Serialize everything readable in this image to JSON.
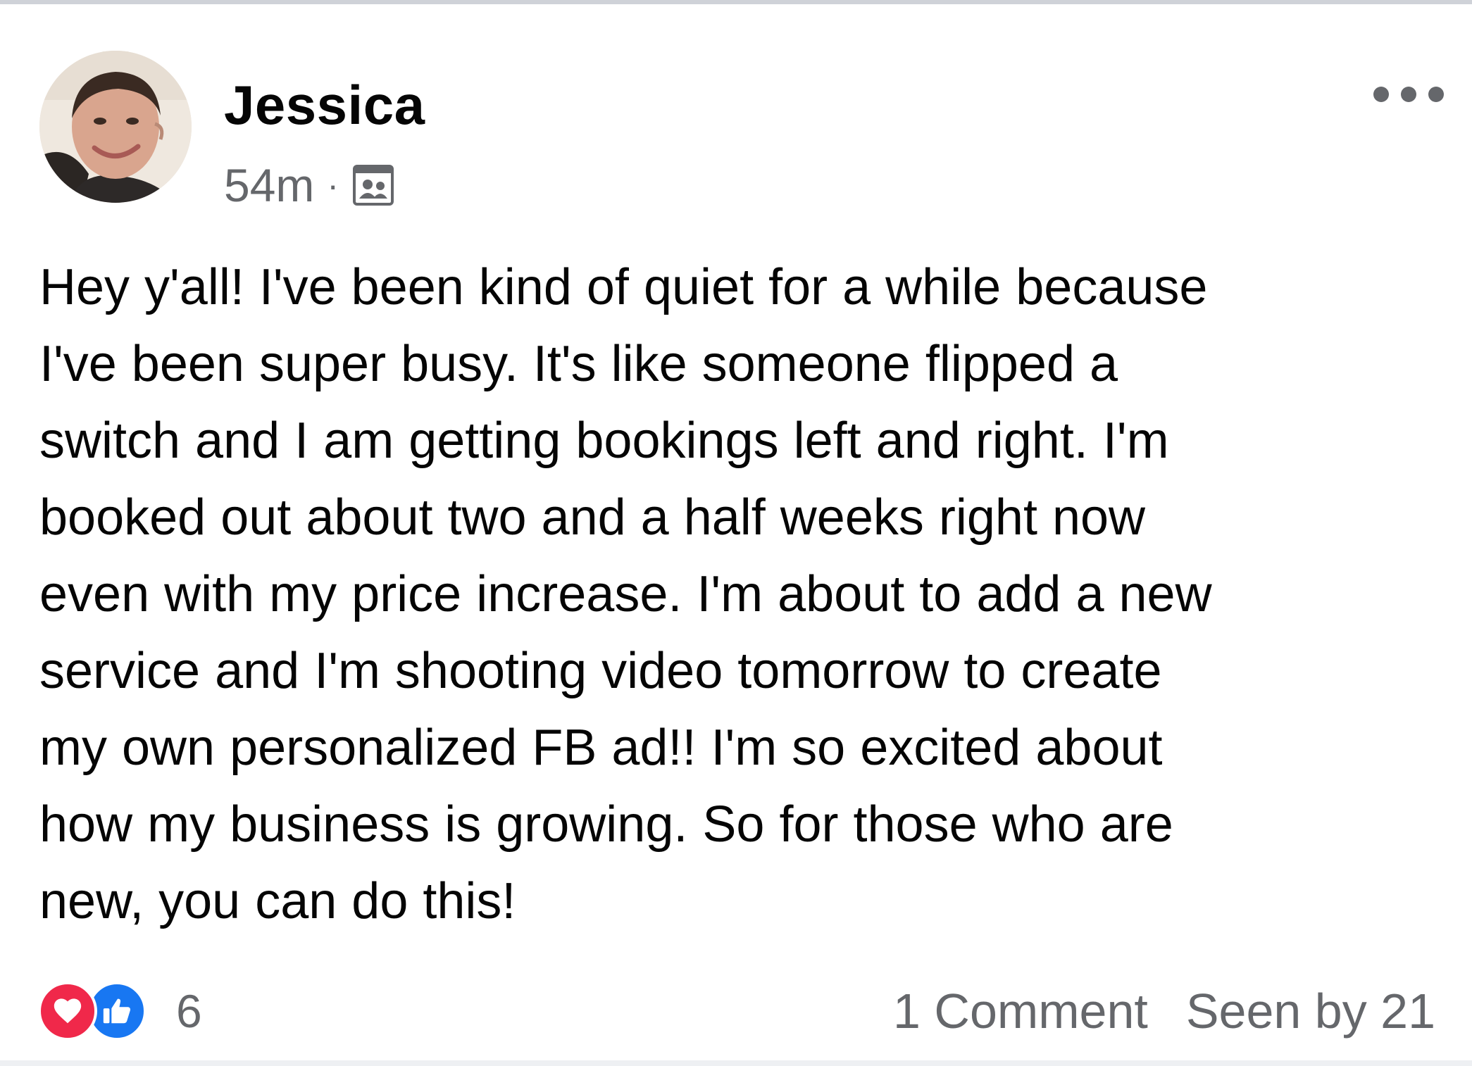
{
  "post": {
    "author": {
      "name": "Jessica",
      "avatar_icon": "user-avatar-photo"
    },
    "meta": {
      "timestamp": "54m",
      "separator": "·",
      "audience_icon": "group-members-icon"
    },
    "options_icon": "more-options-icon",
    "body": "Hey y'all! I've been kind of quiet for a while because\nI've been super busy. It's like someone flipped a\nswitch and I am getting bookings left and right. I'm\nbooked out about two and a half weeks right now\neven with my price increase. I'm about to add a new\nservice and I'm shooting video tomorrow to create\nmy own personalized FB ad!!  I'm so excited about\nhow my business is growing. So for those who are\nnew, you can do this!",
    "footer": {
      "reactions": [
        {
          "type": "love",
          "icon": "love-reaction-icon",
          "color": "#f0284a"
        },
        {
          "type": "like",
          "icon": "like-reaction-icon",
          "color": "#1877f2"
        }
      ],
      "reaction_count": "6",
      "comments": "1 Comment",
      "seen_by": "Seen by 21"
    }
  },
  "colors": {
    "text_primary": "#050505",
    "text_secondary": "#65676b",
    "love_red": "#f0284a",
    "like_blue": "#1877f2"
  }
}
